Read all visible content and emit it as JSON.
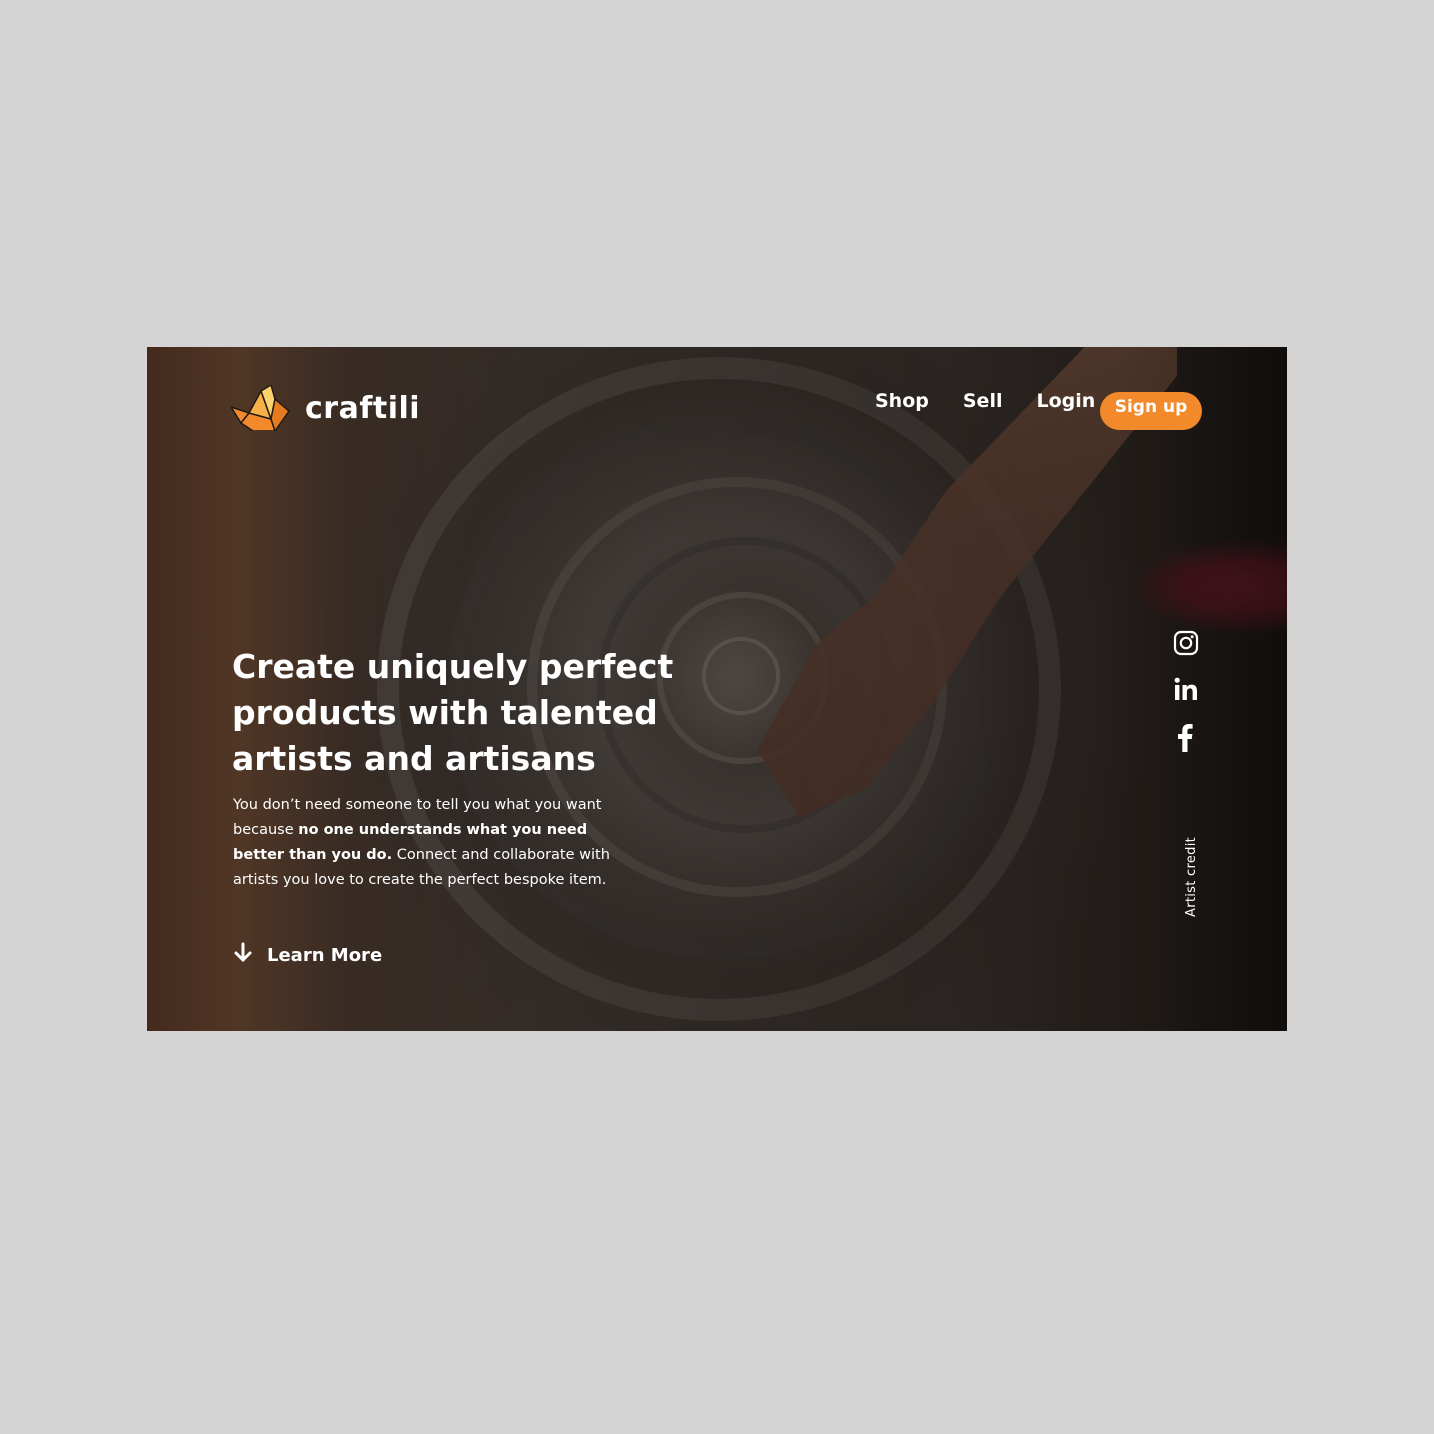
{
  "brand": {
    "name": "craftili",
    "logo_icon": "origami-bird-logo",
    "accent_color": "#f2892a"
  },
  "nav": {
    "shop": "Shop",
    "sell": "Sell",
    "login": "Login",
    "signup": "Sign up"
  },
  "hero": {
    "headline": "Create uniquely perfect products with talented artists and artisans",
    "body": {
      "part1": "You don’t need someone to tell you what you want because ",
      "bold": "no one understands what you need better than you do.",
      "part2": " Connect and collaborate with artists you love to create the perfect bespoke item."
    },
    "learn_more": "Learn More",
    "learn_more_icon": "arrow-down-icon"
  },
  "social": {
    "icons": [
      "instagram-icon",
      "linkedin-icon",
      "facebook-icon"
    ]
  },
  "credit": "Artist credit"
}
